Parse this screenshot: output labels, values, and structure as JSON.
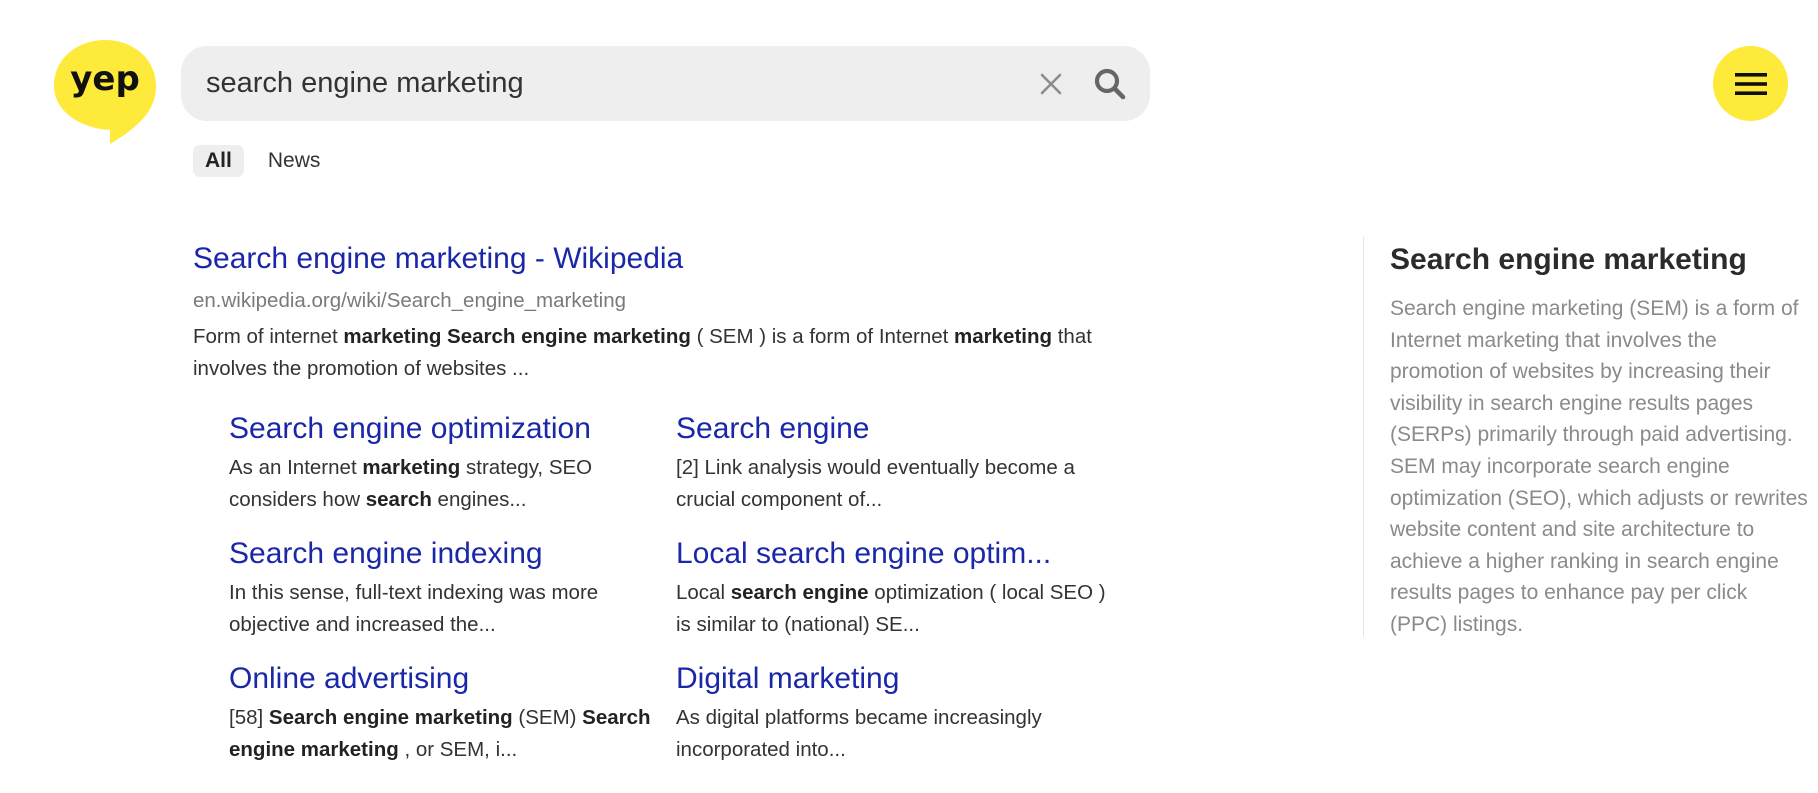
{
  "brand": {
    "logo_text": "yep",
    "logo_color": "#fdea3b"
  },
  "search": {
    "query": "search engine marketing",
    "placeholder": "",
    "clear_icon": "close-icon",
    "submit_icon": "search-icon"
  },
  "menu": {
    "icon": "hamburger-menu-icon"
  },
  "tabs": [
    {
      "label": "All",
      "active": true
    },
    {
      "label": "News",
      "active": false
    }
  ],
  "main_result": {
    "title": "Search engine marketing - Wikipedia",
    "url": "en.wikipedia.org/wiki/Search_engine_marketing",
    "snippet_parts": [
      {
        "text": "Form of internet ",
        "bold": false
      },
      {
        "text": "marketing Search engine marketing",
        "bold": true
      },
      {
        "text": " ( SEM ) is a form of Internet ",
        "bold": false
      },
      {
        "text": "marketing",
        "bold": true
      },
      {
        "text": " that involves the promotion of websites ...",
        "bold": false
      }
    ]
  },
  "sublinks": [
    {
      "title": "Search engine optimization",
      "snippet_parts": [
        {
          "text": "As an Internet ",
          "bold": false
        },
        {
          "text": "marketing",
          "bold": true
        },
        {
          "text": " strategy, SEO considers how ",
          "bold": false
        },
        {
          "text": "search",
          "bold": true
        },
        {
          "text": " engines...",
          "bold": false
        }
      ]
    },
    {
      "title": "Search engine",
      "snippet_parts": [
        {
          "text": "[2] Link analysis would eventually become a crucial component of...",
          "bold": false
        }
      ]
    },
    {
      "title": "Search engine indexing",
      "snippet_parts": [
        {
          "text": "In this sense, full-text indexing was more objective and increased the...",
          "bold": false
        }
      ]
    },
    {
      "title": "Local search engine optim...",
      "snippet_parts": [
        {
          "text": "Local ",
          "bold": false
        },
        {
          "text": "search engine",
          "bold": true
        },
        {
          "text": " optimization ( local SEO ) is similar to (national) SE...",
          "bold": false
        }
      ]
    },
    {
      "title": "Online advertising",
      "snippet_parts": [
        {
          "text": "[58] ",
          "bold": false
        },
        {
          "text": "Search engine marketing",
          "bold": true
        },
        {
          "text": " (SEM) ",
          "bold": false
        },
        {
          "text": "Search engine marketing",
          "bold": true
        },
        {
          "text": " , or SEM, i...",
          "bold": false
        }
      ]
    },
    {
      "title": "Digital marketing",
      "snippet_parts": [
        {
          "text": "As digital platforms became increasingly incorporated into...",
          "bold": false
        }
      ]
    }
  ],
  "knowledge_panel": {
    "title": "Search engine marketing",
    "body": "Search engine marketing (SEM) is a form of Internet marketing that involves the promotion of websites by increasing their visibility in search engine results pages (SERPs) primarily through paid advertising. SEM may incorporate search engine optimization (SEO), which adjusts or rewrites website content and site architecture to achieve a higher ranking in search engine results pages to enhance pay per click (PPC) listings."
  },
  "colors": {
    "link": "#1a27a8",
    "url": "#7a7a7a",
    "search_bg": "#eeeeee",
    "accent_yellow": "#fdea3b",
    "panel_text": "#8a8a8a"
  }
}
